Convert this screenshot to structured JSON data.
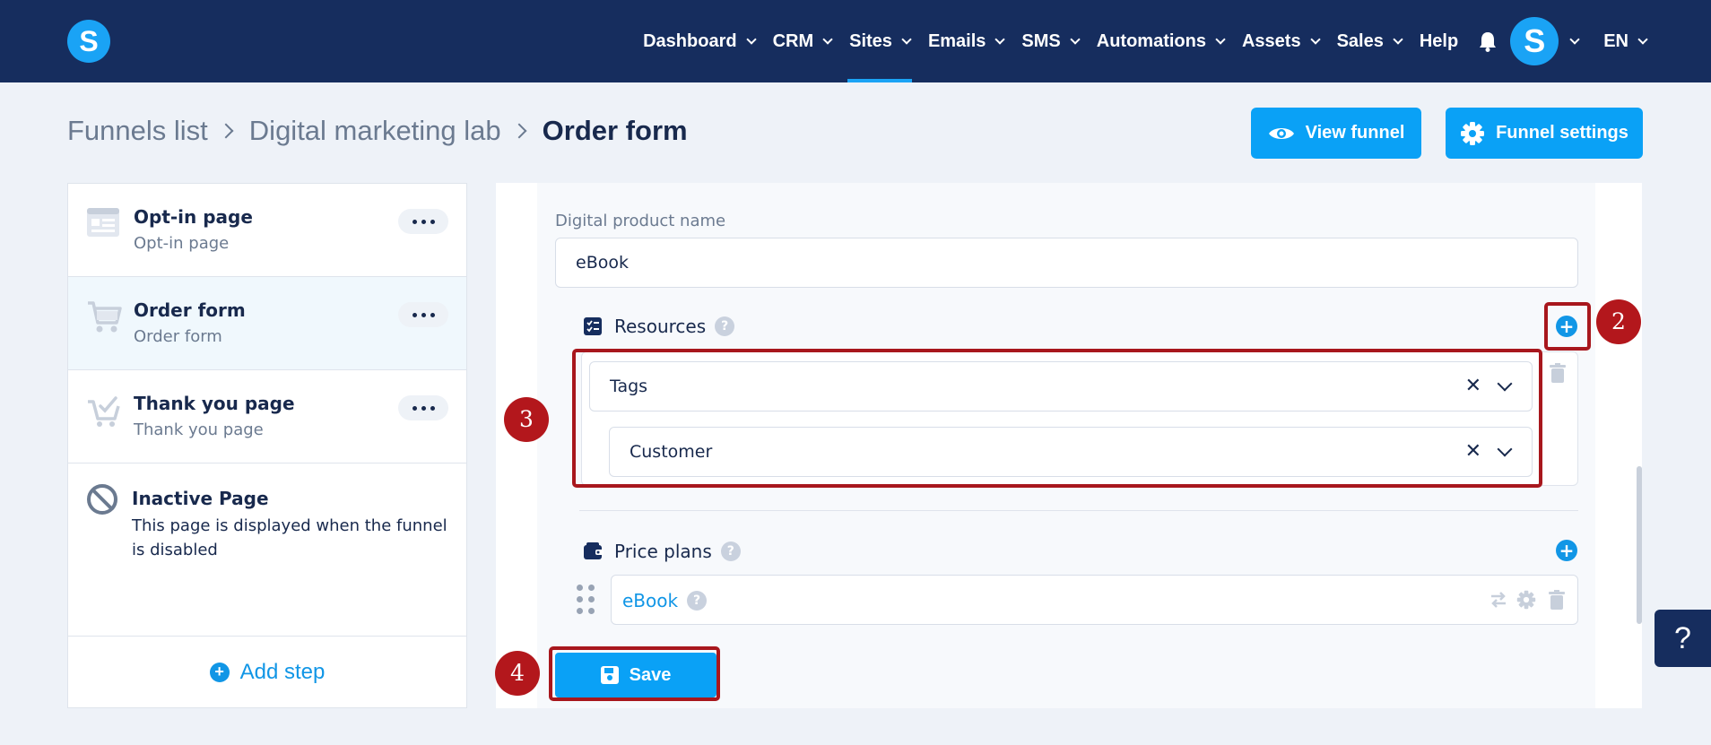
{
  "app": {
    "logo_letter": "S"
  },
  "nav": {
    "items": [
      {
        "label": "Dashboard",
        "has_dropdown": true,
        "active": false
      },
      {
        "label": "CRM",
        "has_dropdown": true,
        "active": false
      },
      {
        "label": "Sites",
        "has_dropdown": true,
        "active": true
      },
      {
        "label": "Emails",
        "has_dropdown": true,
        "active": false
      },
      {
        "label": "SMS",
        "has_dropdown": true,
        "active": false
      },
      {
        "label": "Automations",
        "has_dropdown": true,
        "active": false
      },
      {
        "label": "Assets",
        "has_dropdown": true,
        "active": false
      },
      {
        "label": "Sales",
        "has_dropdown": true,
        "active": false
      },
      {
        "label": "Help",
        "has_dropdown": false,
        "active": false
      }
    ],
    "avatar_letter": "S",
    "language": "EN",
    "accent_color": "#1aa3f5",
    "bar_color": "#162d5e"
  },
  "breadcrumb": {
    "items": [
      "Funnels list",
      "Digital marketing lab"
    ],
    "current": "Order form"
  },
  "header_actions": {
    "view_funnel": "View funnel",
    "funnel_settings": "Funnel settings"
  },
  "sidebar": {
    "steps": [
      {
        "title": "Opt-in page",
        "subtitle": "Opt-in page",
        "icon": "opt-in-page-icon"
      },
      {
        "title": "Order form",
        "subtitle": "Order form",
        "icon": "cart-icon",
        "active": true
      },
      {
        "title": "Thank you page",
        "subtitle": "Thank you page",
        "icon": "cart-check-icon"
      }
    ],
    "inactive": {
      "title": "Inactive Page",
      "description": "This page is displayed when the funnel is disabled"
    },
    "add_step": "Add step"
  },
  "form": {
    "product_name_label": "Digital product name",
    "product_name_value": "eBook",
    "resources_title": "Resources",
    "resources": {
      "type": "Tags",
      "value": "Customer"
    },
    "price_plans_title": "Price plans",
    "price_plan": "eBook",
    "save": "Save"
  },
  "annotations": {
    "add_resource": "2",
    "resources_box": "3",
    "save": "4",
    "color": "#a8171d"
  },
  "help_fab": "?"
}
